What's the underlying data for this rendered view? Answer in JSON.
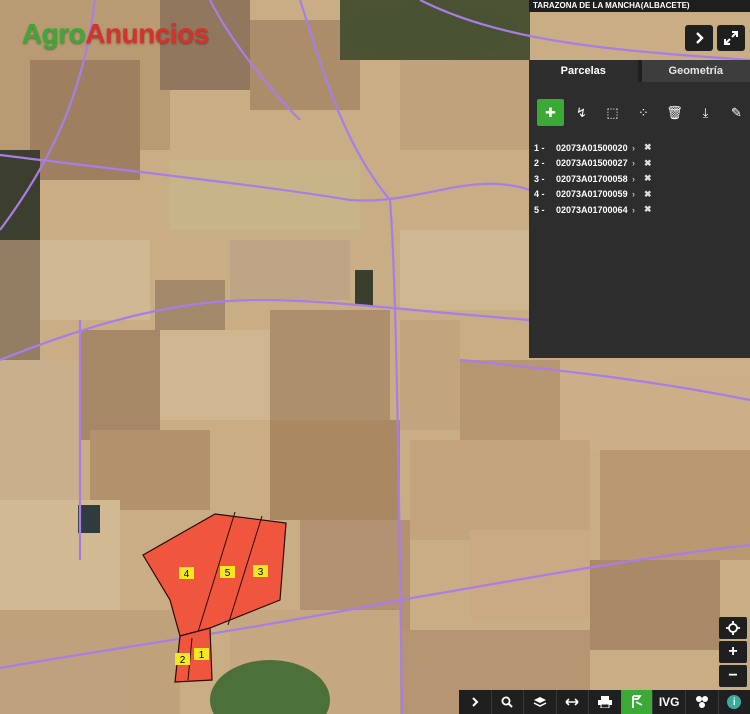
{
  "location_label": "TARAZONA DE LA MANCHA(ALBACETE)",
  "logo": {
    "agro": "Agro",
    "anuncios": "Anuncios"
  },
  "top_buttons": {
    "next_icon": "chevron-right-icon",
    "fullscreen_icon": "expand-icon"
  },
  "panel": {
    "tabs": [
      {
        "label": "Parcelas",
        "active": true
      },
      {
        "label": "Geometría",
        "active": false
      }
    ],
    "tools": [
      "add-parcel-icon",
      "select-parcel-icon",
      "add-area-icon",
      "add-point-icon",
      "delete-icon",
      "download-icon",
      "edit-icon"
    ],
    "parcels": [
      {
        "num": "1 -",
        "code": "02073A01500020"
      },
      {
        "num": "2 -",
        "code": "02073A01500027"
      },
      {
        "num": "3 -",
        "code": "02073A01700058"
      },
      {
        "num": "4 -",
        "code": "02073A01700059"
      },
      {
        "num": "5 -",
        "code": "02073A01700064"
      }
    ]
  },
  "parcel_labels": [
    "1",
    "2",
    "3",
    "4",
    "5"
  ],
  "zoom": {
    "locate_icon": "crosshair-icon",
    "in": "+",
    "out": "−"
  },
  "bottom_toolbar": {
    "buttons": [
      "chevron-right-icon",
      "search-icon",
      "layers-icon",
      "measure-icon",
      "print-icon",
      "parcel-tool-icon",
      "IVG",
      "share-icon",
      "info-icon"
    ],
    "ivg_label": "IVG",
    "info_label": "i"
  },
  "colors": {
    "parcel_fill": "#f0563e",
    "road": "#a87ee6",
    "accent": "#3aa935",
    "panel": "#2d2d2d"
  }
}
